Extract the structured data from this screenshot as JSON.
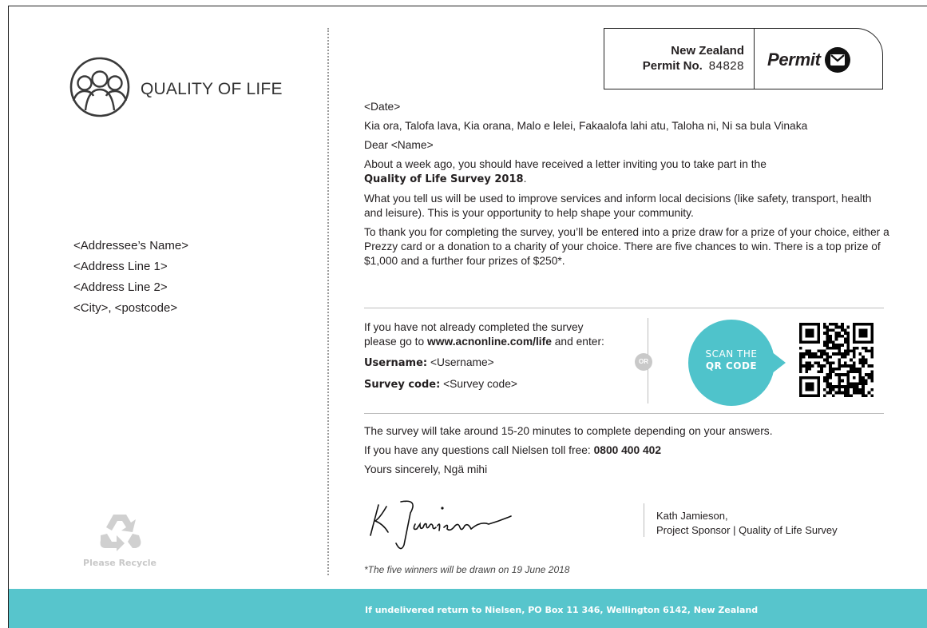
{
  "logo": {
    "text": "QUALITY OF LIFE",
    "icon": "people-circle-icon"
  },
  "address": {
    "lines": [
      "<Addressee’s Name>",
      "<Address Line 1>",
      "<Address Line 2>",
      "<City>, <postcode>"
    ]
  },
  "recycle": {
    "label": "Please Recycle",
    "icon": "recycle-icon"
  },
  "permit": {
    "country": "New Zealand",
    "number_label": "Permit No.",
    "number": "84828",
    "word": "Permit",
    "icon": "envelope-icon"
  },
  "letter": {
    "date": "<Date>",
    "greeting": "Kia ora, Talofa lava, Kia orana, Malo e lelei, Fakaalofa lahi atu, Taloha ni, Ni sa bula Vinaka",
    "dear": "Dear <Name>",
    "intro": "About a week ago, you should have received a letter inviting you to take part in the",
    "survey_name": "Quality of Life Survey 2018",
    "survey_name_suffix": ".",
    "para2": "What you tell us will be used to improve services and inform local decisions (like safety, transport, health and leisure). This is your opportunity to help shape your community.",
    "para3": "To thank you for completing the survey, you’ll be entered into a prize draw for a prize of your choice, either a Prezzy card or a donation to a charity of your choice. There are five chances to win. There is a top prize of $1,000 and a further four prizes of $250*."
  },
  "login": {
    "line1": "If you have not already completed the survey",
    "line2_prefix": "please go to ",
    "url": "www.acnonline.com/life",
    "line2_suffix": " and enter:",
    "username_label": "Username:",
    "username_value": " <Username>",
    "code_label": "Survey code:",
    "code_value": " <Survey code>",
    "or": "OR"
  },
  "scan": {
    "line1": "SCAN THE",
    "line2": "QR CODE",
    "color": "#4fc3cb"
  },
  "closing": {
    "duration": "The survey will take around 15-20 minutes to complete depending on your answers.",
    "questions_prefix": "If you have any questions call Nielsen toll free: ",
    "phone": "0800 400 402",
    "signoff": "Yours sincerely,  Ngä mihi"
  },
  "sponsor": {
    "name": "Kath Jamieson,",
    "title": "Project Sponsor | Quality of Life Survey"
  },
  "footnote": "*The five winners will be drawn on 19 June 2018",
  "footer": {
    "text": "If undelivered return to Nielsen, PO Box 11 346, Wellington 6142, New Zealand",
    "color": "#57c5cc"
  }
}
